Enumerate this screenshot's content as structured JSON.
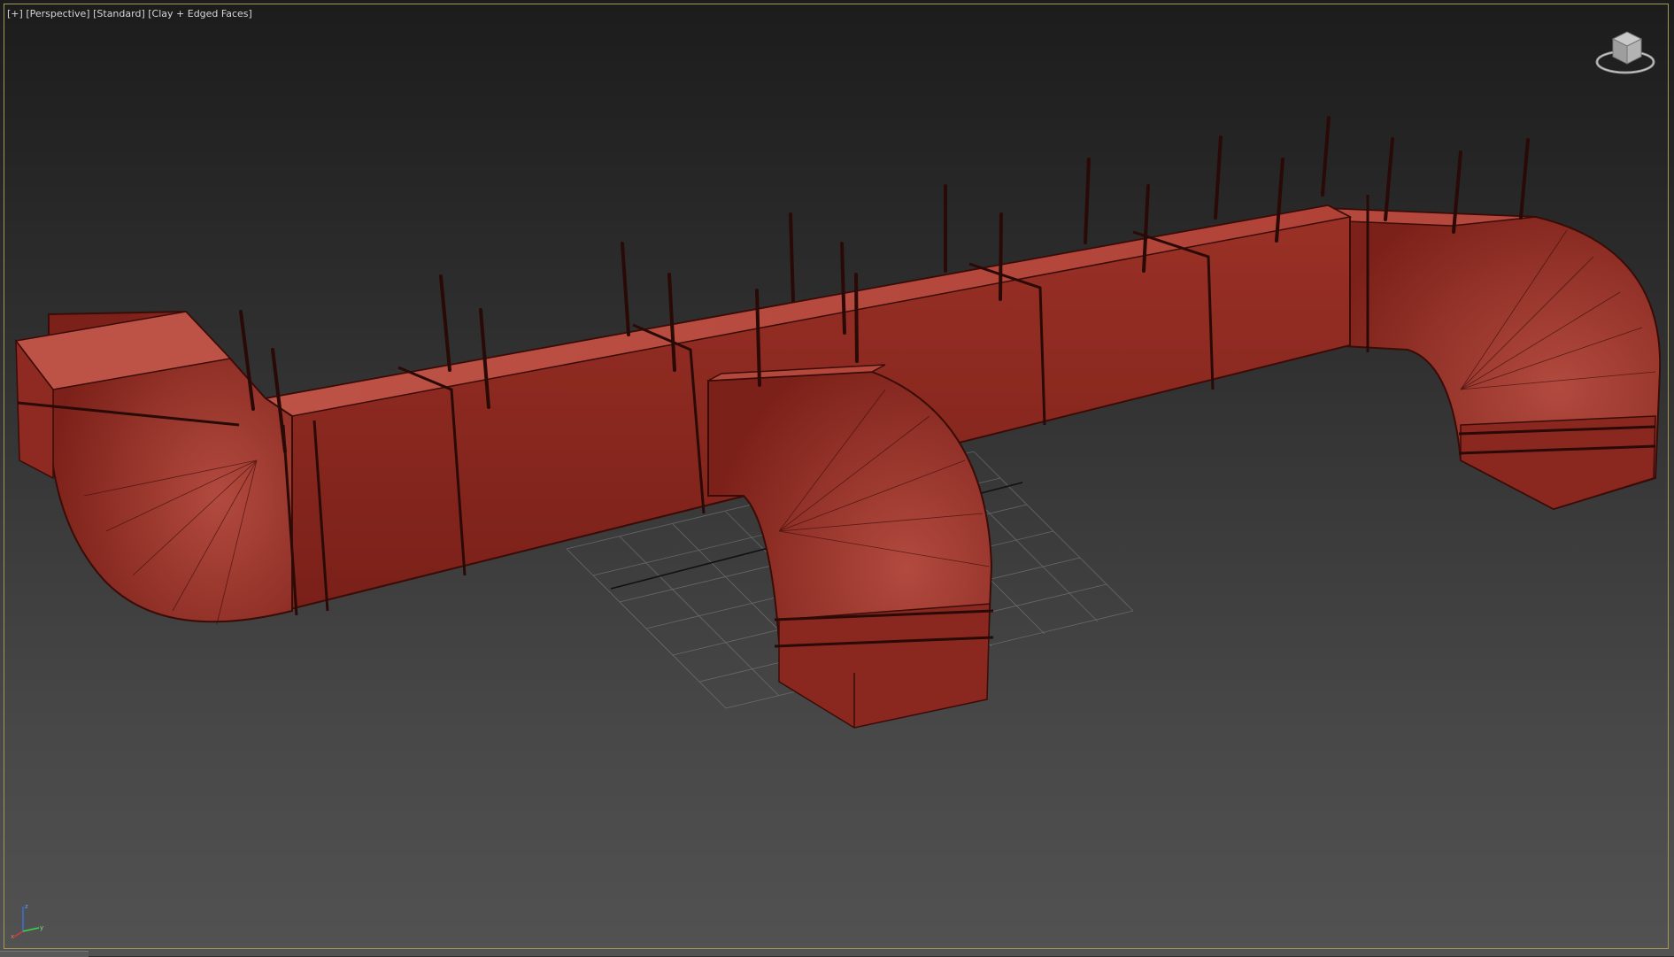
{
  "viewport": {
    "labels": {
      "menu": "[+]",
      "view": "[Perspective]",
      "shading_preset": "[Standard]",
      "display_mode": "[Clay + Edged Faces]"
    },
    "view_cube_icon": "viewcube-icon",
    "axis_icon": "axis-tripod-icon",
    "axis_labels": {
      "x": "x",
      "y": "y",
      "z": "z"
    }
  },
  "colors": {
    "background_top": "#1c1c1c",
    "background_bottom": "#525252",
    "border": "#a49a55",
    "duct_top": "#b5483c",
    "duct_side": "#8e2a22",
    "duct_edge": "#3a0c08",
    "rod": "#2a0a06",
    "grid": "#8a8a8a"
  }
}
